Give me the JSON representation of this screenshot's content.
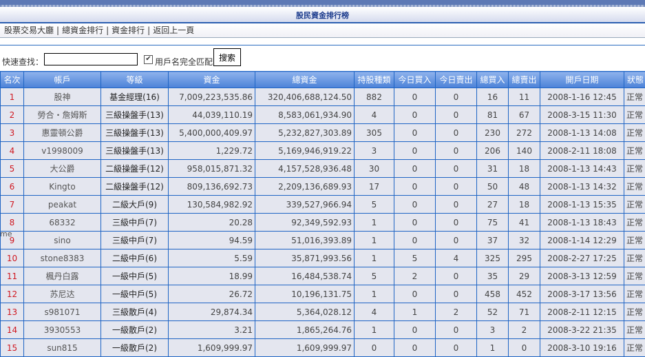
{
  "header": {
    "title": "股民資金排行榜"
  },
  "nav": [
    "股票交易大廳",
    "總資金排行",
    "資金排行",
    "返回上一頁"
  ],
  "search": {
    "label": "快速查找：",
    "value": "",
    "exact_match_label": "用戶名完全匹配",
    "exact_match_checked": true,
    "button": "搜索"
  },
  "table": {
    "columns": [
      "名次",
      "帳戶",
      "等級",
      "資金",
      "總資金",
      "持股種類",
      "今日買入",
      "今日賣出",
      "總買入",
      "總賣出",
      "開戶日期",
      "狀態"
    ],
    "rows": [
      [
        "1",
        "股神",
        "基金經理(16)",
        "7,009,223,535.86",
        "320,406,688,124.50",
        "882",
        "0",
        "0",
        "16",
        "11",
        "2008-1-16 12:45",
        "正常"
      ],
      [
        "2",
        "勞合・詹姆斯",
        "三級操盤手(13)",
        "44,039,110.19",
        "8,583,061,934.90",
        "4",
        "0",
        "0",
        "81",
        "67",
        "2008-3-15 11:30",
        "正常"
      ],
      [
        "3",
        "惠靈頓公爵",
        "三級操盤手(13)",
        "5,400,000,409.97",
        "5,232,827,303.89",
        "305",
        "0",
        "0",
        "230",
        "272",
        "2008-1-13 14:08",
        "正常"
      ],
      [
        "4",
        "v1998009",
        "三級操盤手(13)",
        "1,229.72",
        "5,169,946,919.22",
        "3",
        "0",
        "0",
        "206",
        "140",
        "2008-2-11 18:08",
        "正常"
      ],
      [
        "5",
        "大公爵",
        "二級操盤手(12)",
        "958,015,871.32",
        "4,157,528,936.48",
        "30",
        "0",
        "0",
        "31",
        "18",
        "2008-1-13 14:43",
        "正常"
      ],
      [
        "6",
        "Kingto",
        "二級操盤手(12)",
        "809,136,692.73",
        "2,209,136,689.93",
        "17",
        "0",
        "0",
        "50",
        "48",
        "2008-1-13 14:32",
        "正常"
      ],
      [
        "7",
        "peakat",
        "二級大戶(9)",
        "130,584,982.92",
        "339,527,966.94",
        "5",
        "0",
        "0",
        "27",
        "18",
        "2008-1-13 15:35",
        "正常"
      ],
      [
        "8",
        "68332",
        "三級中戶(7)",
        "20.28",
        "92,349,592.93",
        "1",
        "0",
        "0",
        "75",
        "41",
        "2008-1-13 18:43",
        "正常"
      ],
      [
        "9",
        "sino",
        "三級中戶(7)",
        "94.59",
        "51,016,393.89",
        "1",
        "0",
        "0",
        "37",
        "32",
        "2008-1-14 12:29",
        "正常"
      ],
      [
        "10",
        "stone8383",
        "二級中戶(6)",
        "5.59",
        "35,871,993.56",
        "1",
        "5",
        "4",
        "325",
        "295",
        "2008-2-27 17:25",
        "正常"
      ],
      [
        "11",
        "楓丹白露",
        "一級中戶(5)",
        "18.99",
        "16,484,538.74",
        "5",
        "2",
        "0",
        "35",
        "29",
        "2008-3-13 12:59",
        "正常"
      ],
      [
        "12",
        "苏尼达",
        "一級中戶(5)",
        "26.72",
        "10,196,131.75",
        "1",
        "0",
        "0",
        "458",
        "452",
        "2008-3-17 13:56",
        "正常"
      ],
      [
        "13",
        "s981071",
        "三級散戶(4)",
        "29,874.34",
        "5,364,028.12",
        "4",
        "1",
        "2",
        "52",
        "71",
        "2008-2-11 12:15",
        "正常"
      ],
      [
        "14",
        "3930553",
        "一級散戶(2)",
        "3.21",
        "1,865,264.76",
        "1",
        "0",
        "0",
        "3",
        "2",
        "2008-3-22 21:35",
        "正常"
      ],
      [
        "15",
        "sun815",
        "一級散戶(2)",
        "1,609,999.97",
        "1,609,999.97",
        "0",
        "0",
        "0",
        "1",
        "0",
        "2008-3-10 19:16",
        "正常"
      ]
    ]
  },
  "stray_text": "me",
  "colors": {
    "header_bg": "#4c82d8",
    "border": "#1e64c4",
    "rank": "#d01820",
    "row_bg": "#e4e6ef"
  }
}
